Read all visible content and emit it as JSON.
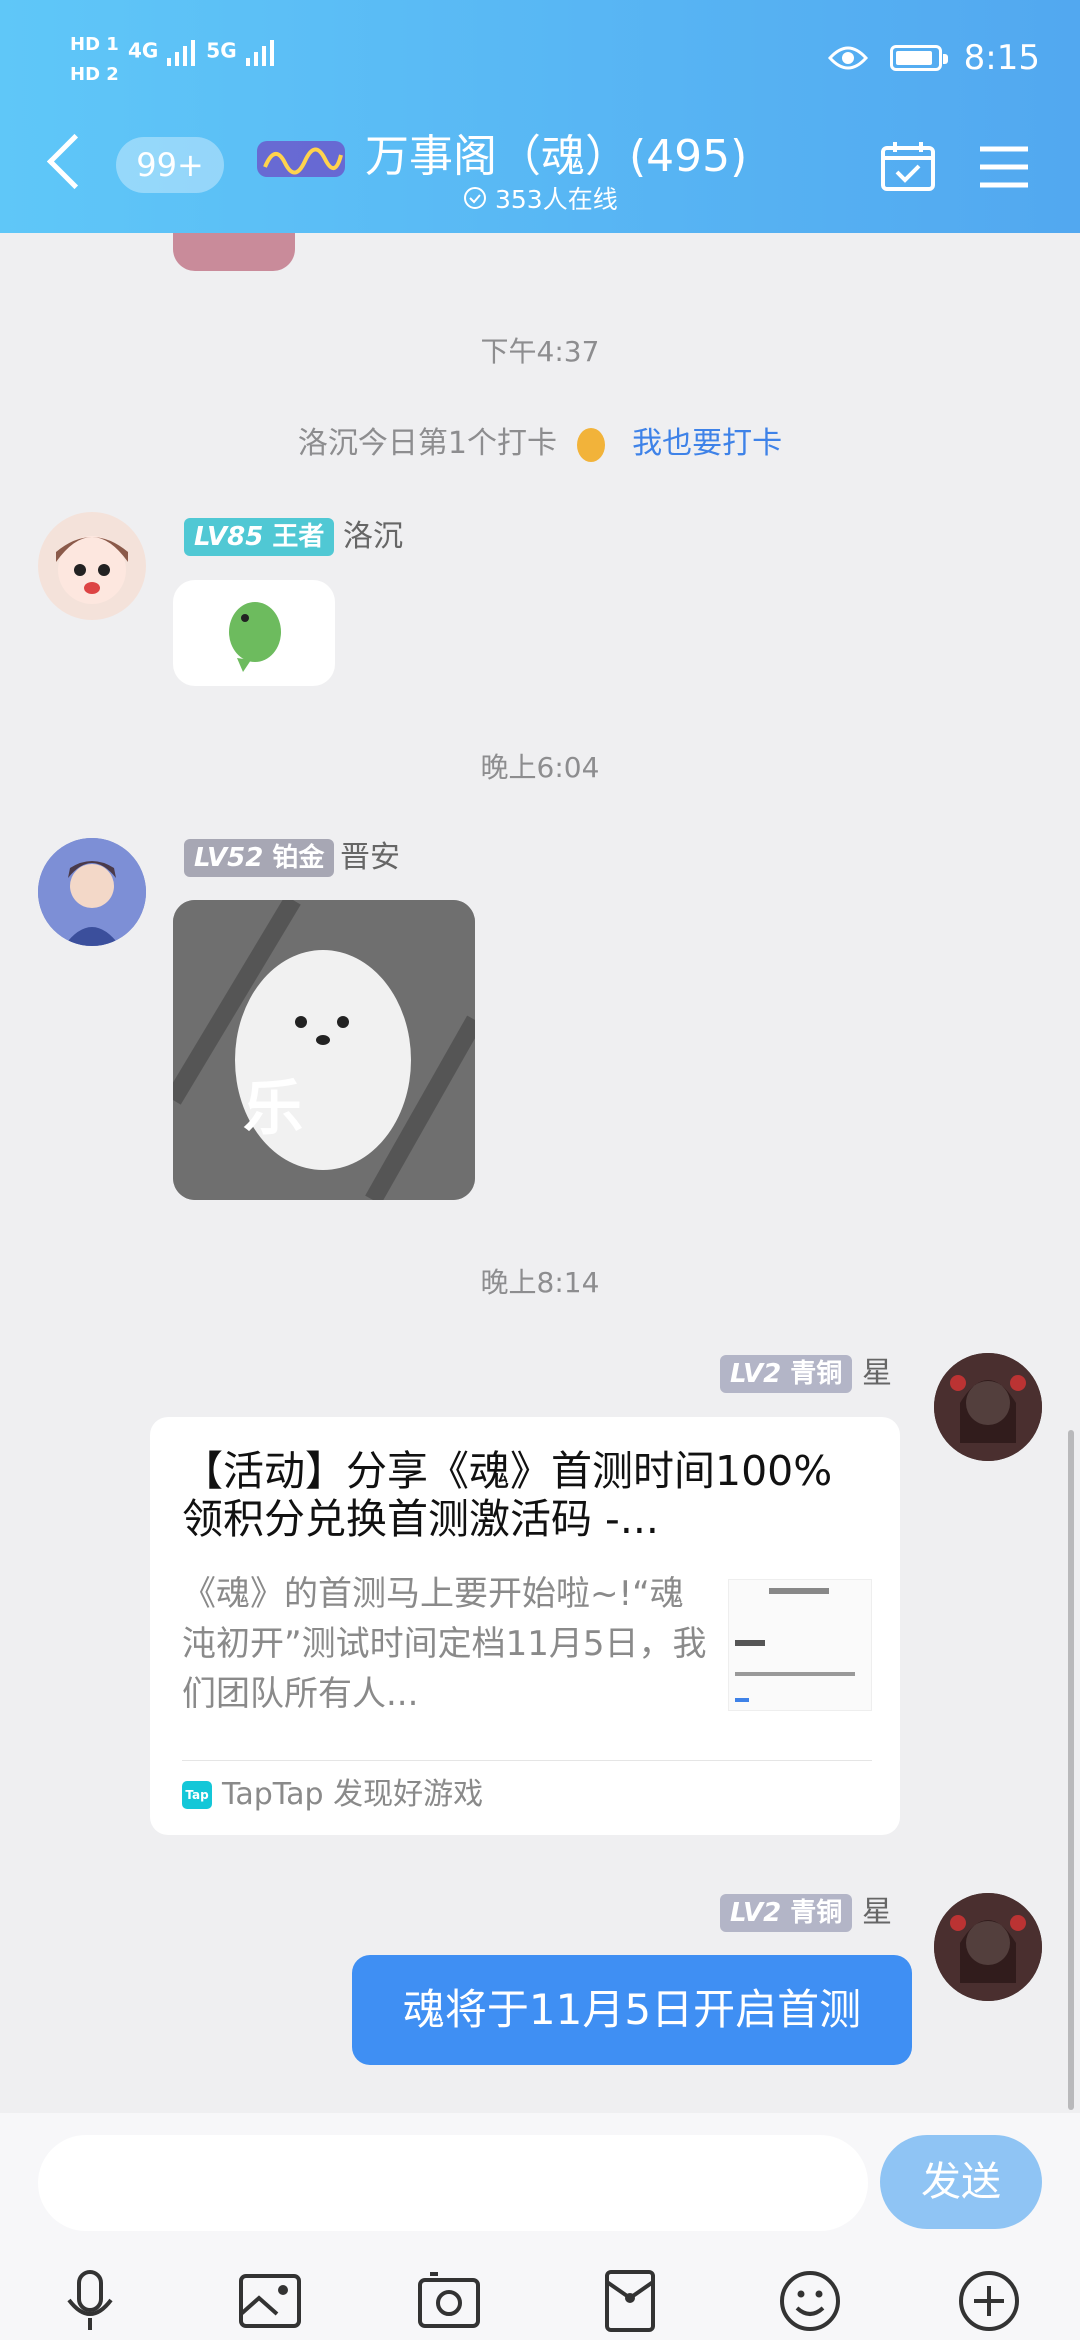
{
  "status_bar": {
    "hd1": "HD 1",
    "hd2": "HD 2",
    "net1": "4G",
    "net2": "5G",
    "time": "8:15",
    "battery_level": 0.9
  },
  "header": {
    "unread_badge": "99+",
    "title": "万事阁（魂）(495)",
    "online_text": "353人在线"
  },
  "messages": {
    "ts1": "下午4:37",
    "checkin_text": "洛沉今日第1个打卡",
    "checkin_link": "我也要打卡",
    "msg1": {
      "lv": "LV85",
      "rank": "王者",
      "name": "洛沉",
      "lv_color": "#50c8d4"
    },
    "ts2": "晚上6:04",
    "msg2": {
      "lv": "LV52",
      "rank": "铂金",
      "name": "晋安",
      "lv_color": "#a7a7b4",
      "image_text": "乐"
    },
    "ts3": "晚上8:14",
    "msg3": {
      "lv": "LV2",
      "rank": "青铜",
      "name": "星",
      "lv_color": "#b3b5c7",
      "card_title": "【活动】分享《魂》首测时间100%领积分兑换首测激活码 -...",
      "card_desc": "《魂》的首测马上要开始啦~!“魂沌初开”测试时间定档11月5日，我们团队所有人...",
      "card_source": "TapTap 发现好游戏",
      "tap_logo_text": "Tap"
    },
    "msg4": {
      "lv": "LV2",
      "rank": "青铜",
      "name": "星",
      "lv_color": "#b3b5c7",
      "text": "魂将于11月5日开启首测"
    }
  },
  "input_bar": {
    "send_label": "发送",
    "tools": [
      "microphone-icon",
      "image-icon",
      "camera-icon",
      "red-packet-icon",
      "emoji-icon",
      "plus-icon"
    ]
  },
  "colors": {
    "header_start": "#5fc7f8",
    "header_end": "#52a8f0",
    "accent": "#3f8ff3",
    "link": "#3e82e8"
  }
}
